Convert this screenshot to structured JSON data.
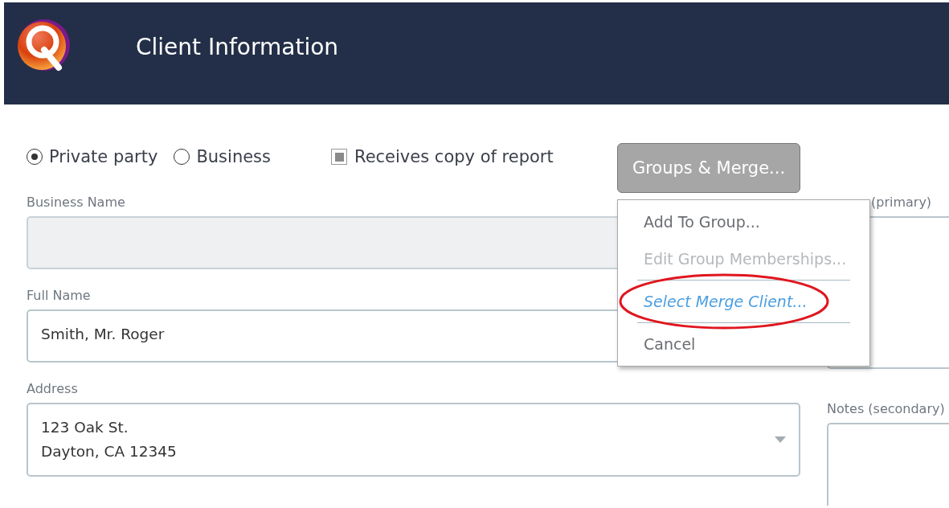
{
  "header": {
    "title": "Client Information"
  },
  "party_type": [
    {
      "label": "Private party",
      "selected": true
    },
    {
      "label": "Business",
      "selected": false
    }
  ],
  "receives_copy": {
    "label": "Receives copy of report",
    "checked": true
  },
  "groups_button": {
    "label": "Groups & Merge..."
  },
  "menu": {
    "items": [
      {
        "kind": "item",
        "label": "Add To Group...",
        "disabled": false,
        "hovered": false,
        "circled": false
      },
      {
        "kind": "item",
        "label": "Edit Group Memberships...",
        "disabled": true,
        "hovered": false,
        "circled": false
      },
      {
        "kind": "separator"
      },
      {
        "kind": "item",
        "label": "Select Merge Client...",
        "disabled": false,
        "hovered": true,
        "circled": true
      },
      {
        "kind": "separator"
      },
      {
        "kind": "item",
        "label": "Cancel",
        "disabled": false,
        "hovered": false,
        "circled": false
      }
    ]
  },
  "fields": [
    {
      "label": "Business Name",
      "disabled": true
    },
    {
      "label": "Full Name",
      "lines": [
        "Smith, Mr. Roger"
      ],
      "disabled": false
    },
    {
      "label": "Address",
      "lines": [
        "123 Oak St.",
        "Dayton, CA 12345"
      ],
      "disabled": false,
      "dropdown": true
    }
  ],
  "notes": [
    {
      "label": "(primary)"
    },
    {
      "label": "Notes (secondary)"
    }
  ]
}
